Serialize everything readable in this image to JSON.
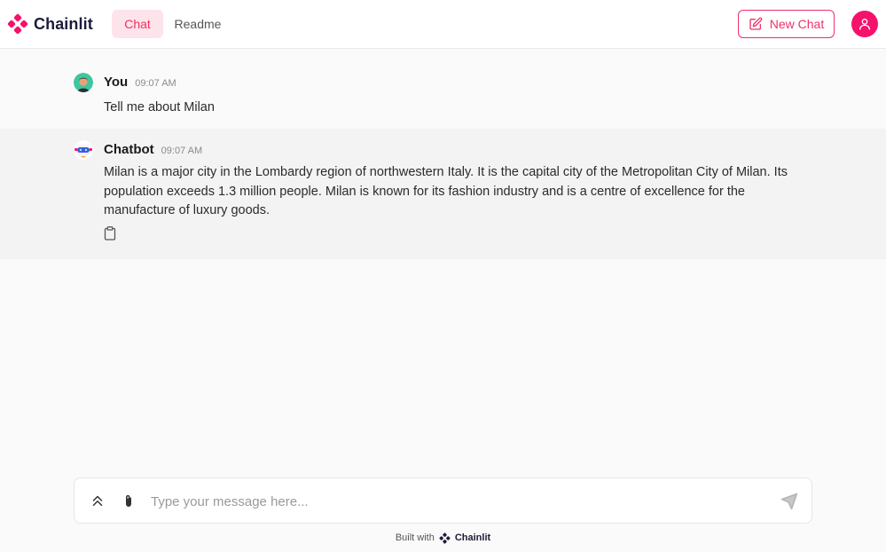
{
  "app": {
    "brand_name": "Chainlit",
    "brand_color": "#f5126a"
  },
  "header": {
    "tabs": [
      {
        "label": "Chat",
        "active": true
      },
      {
        "label": "Readme",
        "active": false
      }
    ],
    "new_chat_label": "New Chat",
    "user_icon": "user-icon"
  },
  "messages": [
    {
      "author": "You",
      "time": "09:07 AM",
      "text": "Tell me about Milan"
    },
    {
      "author": "Chatbot",
      "time": "09:07 AM",
      "text": "Milan is a major city in the Lombardy region of northwestern Italy. It is the capital city of the Metropolitan City of Milan. Its population exceeds 1.3 million people. Milan is known for its fashion industry and is a centre of excellence for the manufacture of luxury goods.",
      "actions": [
        "clipboard-icon"
      ]
    }
  ],
  "composer": {
    "placeholder": "Type your message here...",
    "value": ""
  },
  "footer": {
    "built_with": "Built with",
    "brand": "Chainlit"
  }
}
